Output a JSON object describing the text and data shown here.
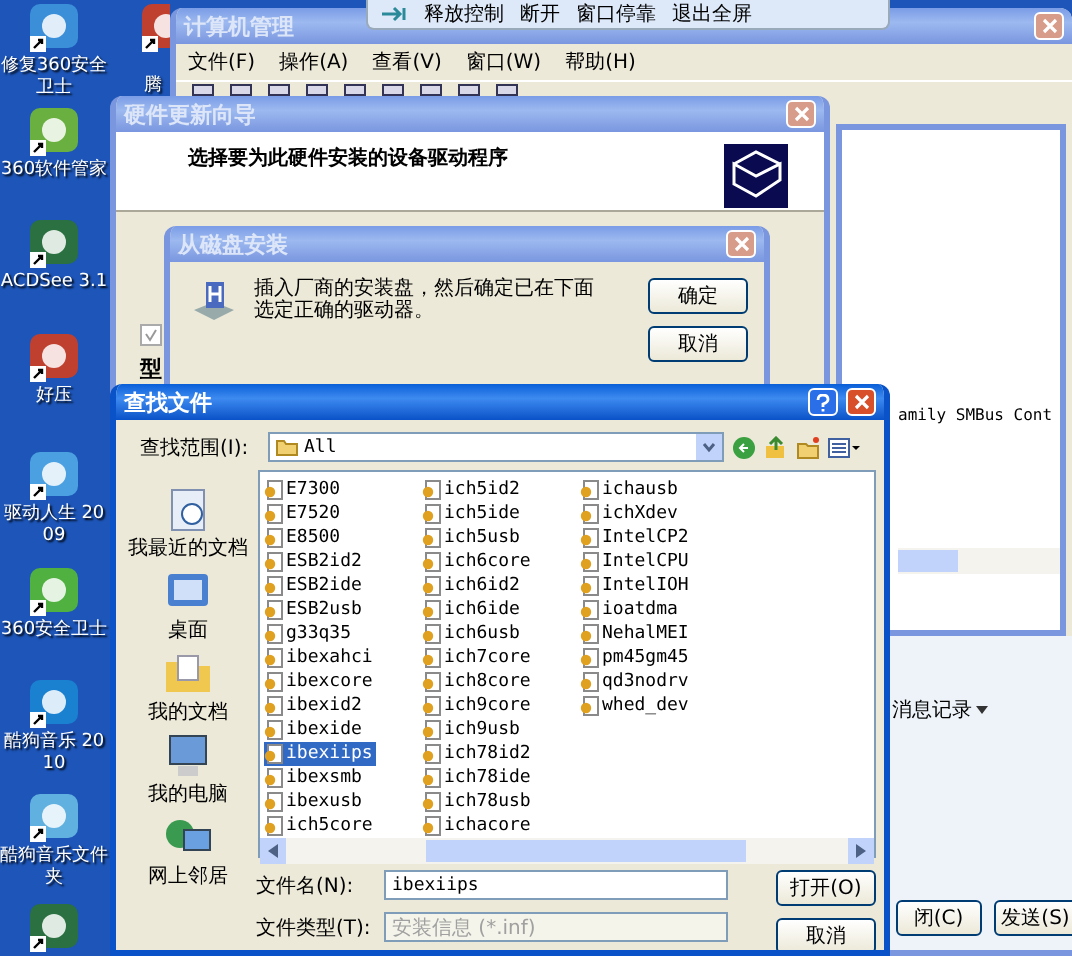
{
  "desktop_icons": [
    {
      "label": "修复360安全卫士"
    },
    {
      "label": "360软件管家"
    },
    {
      "label": "ACDSee 3.1"
    },
    {
      "label": "好压"
    },
    {
      "label": "驱动人生 2009"
    },
    {
      "label": "360安全卫士"
    },
    {
      "label": "酷狗音乐 2010"
    },
    {
      "label": "酷狗音乐文件夹"
    }
  ],
  "second_column_icon": {
    "label": "腾"
  },
  "remote_toolbar": {
    "buttons": [
      "释放控制",
      "断开",
      "窗口停靠",
      "退出全屏"
    ]
  },
  "computer_management": {
    "title": "计算机管理",
    "active": false,
    "menu": [
      "文件(F)",
      "操作(A)",
      "查看(V)",
      "窗口(W)",
      "帮助(H)"
    ],
    "panel_text": "amily SMBus Cont",
    "message_log": "消息记录",
    "buttons": [
      "闭(C)",
      "发送(S)"
    ]
  },
  "hardware_wizard": {
    "title": "硬件更新向导",
    "active": false,
    "heading": "选择要为此硬件安装的设备驱动程序",
    "checkbox": {
      "checked": true
    },
    "column_label": "型"
  },
  "install_from_disk": {
    "title": "从磁盘安装",
    "active": false,
    "message": "插入厂商的安装盘，然后确定已在下面选定正确的驱动器。",
    "buttons": [
      "确定",
      "取消"
    ]
  },
  "find_file": {
    "title": "查找文件",
    "active": true,
    "look_in_label": "查找范围(I):",
    "look_in": "All",
    "places": [
      "我最近的文档",
      "桌面",
      "我的文档",
      "我的电脑",
      "网上邻居"
    ],
    "files": [
      {
        "name": "E7300",
        "selected": false
      },
      {
        "name": "E7520",
        "selected": false
      },
      {
        "name": "E8500",
        "selected": false
      },
      {
        "name": "ESB2id2",
        "selected": false
      },
      {
        "name": "ESB2ide",
        "selected": false
      },
      {
        "name": "ESB2usb",
        "selected": false
      },
      {
        "name": "g33q35",
        "selected": false
      },
      {
        "name": "ibexahci",
        "selected": false
      },
      {
        "name": "ibexcore",
        "selected": false
      },
      {
        "name": "ibexid2",
        "selected": false
      },
      {
        "name": "ibexide",
        "selected": false
      },
      {
        "name": "ibexiips",
        "selected": true
      },
      {
        "name": "ibexsmb",
        "selected": false
      },
      {
        "name": "ibexusb",
        "selected": false
      },
      {
        "name": "ich5core",
        "selected": false
      },
      {
        "name": "ich5id2",
        "selected": false
      },
      {
        "name": "ich5ide",
        "selected": false
      },
      {
        "name": "ich5usb",
        "selected": false
      },
      {
        "name": "ich6core",
        "selected": false
      },
      {
        "name": "ich6id2",
        "selected": false
      },
      {
        "name": "ich6ide",
        "selected": false
      },
      {
        "name": "ich6usb",
        "selected": false
      },
      {
        "name": "ich7core",
        "selected": false
      },
      {
        "name": "ich8core",
        "selected": false
      },
      {
        "name": "ich9core",
        "selected": false
      },
      {
        "name": "ich9usb",
        "selected": false
      },
      {
        "name": "ich78id2",
        "selected": false
      },
      {
        "name": "ich78ide",
        "selected": false
      },
      {
        "name": "ich78usb",
        "selected": false
      },
      {
        "name": "ichacore",
        "selected": false
      },
      {
        "name": "ichausb",
        "selected": false
      },
      {
        "name": "ichXdev",
        "selected": false
      },
      {
        "name": "IntelCP2",
        "selected": false
      },
      {
        "name": "IntelCPU",
        "selected": false
      },
      {
        "name": "IntelIOH",
        "selected": false
      },
      {
        "name": "ioatdma",
        "selected": false
      },
      {
        "name": "NehalMEI",
        "selected": false
      },
      {
        "name": "pm45gm45",
        "selected": false
      },
      {
        "name": "qd3nodrv",
        "selected": false
      },
      {
        "name": "whed_dev",
        "selected": false
      }
    ],
    "file_name_label": "文件名(N):",
    "file_name": "ibexiips",
    "file_type_label": "文件类型(T):",
    "file_type": "安装信息 (*.inf)",
    "file_type_disabled": true,
    "buttons": [
      "打开(O)",
      "取消"
    ]
  }
}
